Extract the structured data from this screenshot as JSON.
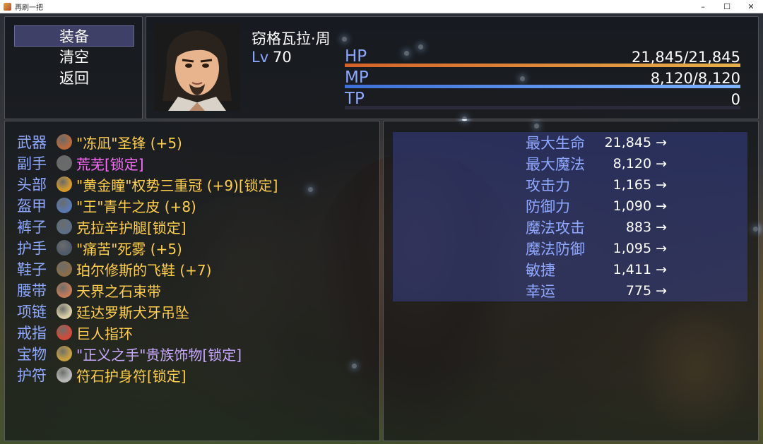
{
  "window": {
    "title": "再刷一把",
    "controls": {
      "minimize": "–",
      "maximize": "☐",
      "close": "✕"
    }
  },
  "commands": [
    {
      "label": "装备",
      "selected": true
    },
    {
      "label": "清空",
      "selected": false
    },
    {
      "label": "返回",
      "selected": false
    }
  ],
  "actor": {
    "name": "窃格瓦拉·周",
    "level_label": "Lv",
    "level": "70",
    "hp_label": "HP",
    "hp": "21,845/21,845",
    "hp_fraction": 1.0,
    "mp_label": "MP",
    "mp": "8,120/8,120",
    "mp_fraction": 1.0,
    "tp_label": "TP",
    "tp": "0",
    "tp_fraction": 0.0
  },
  "equipment": [
    {
      "slot": "武器",
      "item": "\"冻凪\"圣锋 (+5)",
      "color": "#ffcf4a",
      "icon": "sword-icon",
      "icon_color": "#b86a3c"
    },
    {
      "slot": "副手",
      "item": "荒芜[锁定]",
      "color": "#ff6bff",
      "icon": "orb-icon",
      "icon_color": "#6a6a6a"
    },
    {
      "slot": "头部",
      "item": "\"黄金瞳\"权势三重冠 (+9)[锁定]",
      "color": "#ffcf4a",
      "icon": "crown-icon",
      "icon_color": "#d49a2a"
    },
    {
      "slot": "盔甲",
      "item": "\"王\"青牛之皮 (+8)",
      "color": "#ffcf4a",
      "icon": "armor-icon",
      "icon_color": "#5a79b0"
    },
    {
      "slot": "裤子",
      "item": "克拉辛护腿[锁定]",
      "color": "#ffcf4a",
      "icon": "leggings-icon",
      "icon_color": "#5d6f86"
    },
    {
      "slot": "护手",
      "item": "\"痛苦\"死雾 (+5)",
      "color": "#ffcf4a",
      "icon": "gauntlet-icon",
      "icon_color": "#4f5a6a"
    },
    {
      "slot": "鞋子",
      "item": "珀尔修斯的飞鞋 (+7)",
      "color": "#ffcf4a",
      "icon": "boots-icon",
      "icon_color": "#8a6d4a"
    },
    {
      "slot": "腰带",
      "item": "天界之石束带",
      "color": "#ffcf4a",
      "icon": "belt-icon",
      "icon_color": "#c27a5a"
    },
    {
      "slot": "项链",
      "item": "廷达罗斯犬牙吊坠",
      "color": "#ffcf4a",
      "icon": "pendant-icon",
      "icon_color": "#d8cfa8"
    },
    {
      "slot": "戒指",
      "item": "巨人指环",
      "color": "#ffcf4a",
      "icon": "ring-icon",
      "icon_color": "#d24a3a"
    },
    {
      "slot": "宝物",
      "item": "\"正义之手\"贵族饰物[锁定]",
      "color": "#c9a8ff",
      "icon": "trinket-icon",
      "icon_color": "#c8a040"
    },
    {
      "slot": "护符",
      "item": "符石护身符[锁定]",
      "color": "#ffcf4a",
      "icon": "rune-stone-icon",
      "icon_color": "#b8b8b8"
    }
  ],
  "stats": [
    {
      "name": "最大生命",
      "value": "21,845",
      "arrow": "→"
    },
    {
      "name": "最大魔法",
      "value": "8,120",
      "arrow": "→"
    },
    {
      "name": "攻击力",
      "value": "1,165",
      "arrow": "→"
    },
    {
      "name": "防御力",
      "value": "1,090",
      "arrow": "→"
    },
    {
      "name": "魔法攻击",
      "value": "883",
      "arrow": "→"
    },
    {
      "name": "魔法防御",
      "value": "1,095",
      "arrow": "→"
    },
    {
      "name": "敏捷",
      "value": "1,411",
      "arrow": "→"
    },
    {
      "name": "幸运",
      "value": "775",
      "arrow": "→"
    }
  ],
  "colors": {
    "system_blue": "#8fa8ff",
    "hp_gradient": [
      "#d4622a",
      "#e6b04a"
    ],
    "mp_gradient": [
      "#3d6fd8",
      "#7fb3ff"
    ]
  }
}
